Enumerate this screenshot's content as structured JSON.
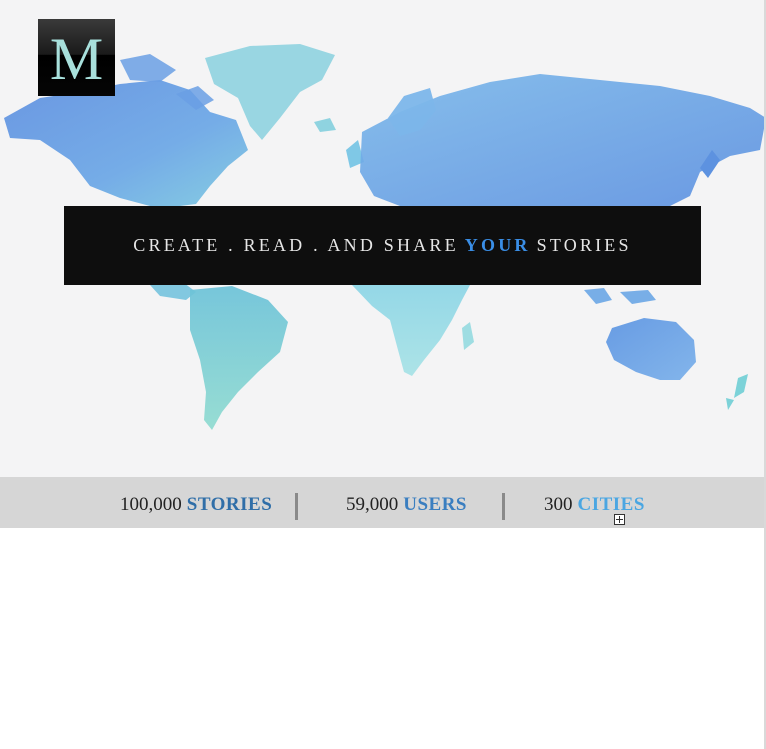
{
  "logo": {
    "letter": "M"
  },
  "banner": {
    "part1": "CREATE . READ . AND SHARE",
    "highlight": "YOUR",
    "part2": "STORIES"
  },
  "stats": [
    {
      "number": "100,000",
      "label": "STORIES"
    },
    {
      "number": "59,000",
      "label": "USERS"
    },
    {
      "number": "300",
      "label": "CITIES"
    }
  ],
  "colors": {
    "hero_bg": "#f4f4f5",
    "banner_bg": "#0e0e0e",
    "accent": "#3a8ee6",
    "stats_bg": "#d6d6d6",
    "map_blue": "#5b9be0",
    "map_teal": "#7fd3d8"
  },
  "icons": {
    "expand": "expand-plus-icon"
  }
}
